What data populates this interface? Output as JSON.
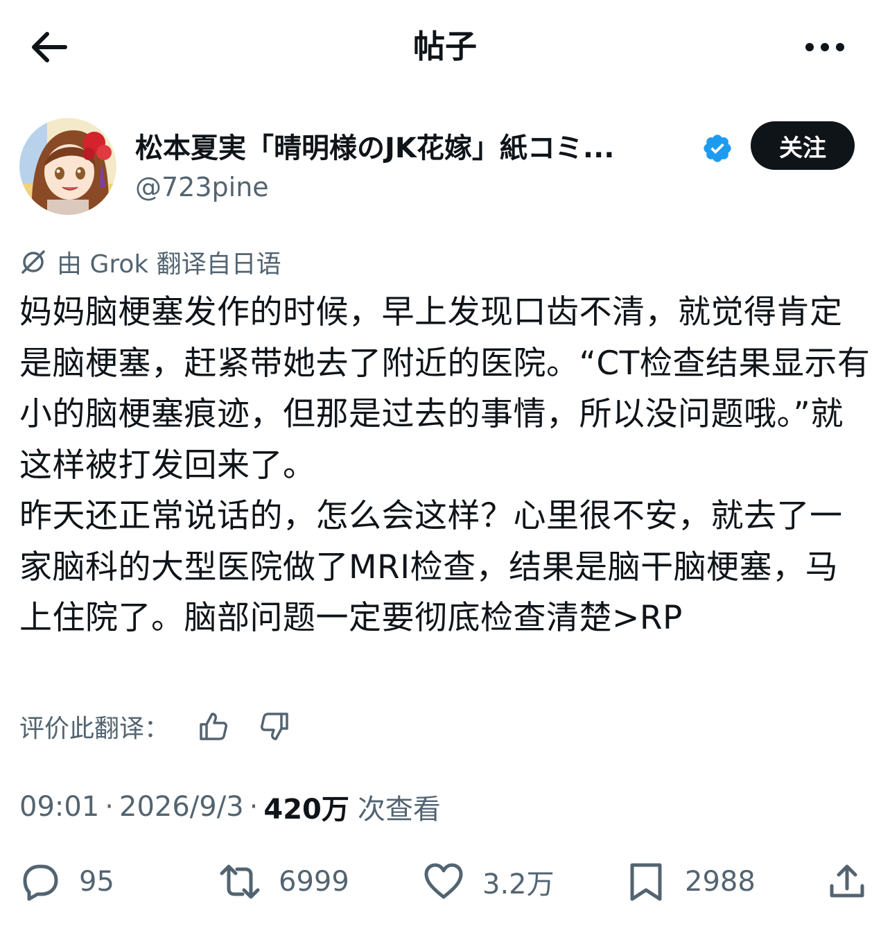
{
  "header": {
    "title": "帖子"
  },
  "author": {
    "display_name": "松本夏実「晴明様のJK花嫁」紙コミ...",
    "handle": "@723pine",
    "follow_label": "关注"
  },
  "translation": {
    "note": "由 Grok 翻译自日语",
    "rate_label": "评价此翻译："
  },
  "post": {
    "paragraph_1": "妈妈脑梗塞发作的时候，早上发现口齿不清，就觉得肯定是脑梗塞，赶紧带她去了附近的医院。“CT检查结果显示有小的脑梗塞痕迹，但那是过去的事情，所以没问题哦。”就这样被打发回来了。",
    "paragraph_2": "昨天还正常说话的，怎么会这样？心里很不安，就去了一家脑科的大型医院做了MRI检查，结果是脑干脑梗塞，马上住院了。脑部问题一定要彻底检查清楚>RP"
  },
  "meta": {
    "time": "09:01",
    "date": "2026/9/3",
    "separator": "·",
    "views_count": "420万",
    "views_label": "次查看"
  },
  "actions": {
    "replies": "95",
    "reposts": "6999",
    "likes": "3.2万",
    "bookmarks": "2988"
  },
  "icons": {
    "back": "arrow-left-icon",
    "more": "more-horizontal-icon",
    "verified": "verified-badge-icon",
    "grok": "grok-icon",
    "thumb_up": "thumbs-up-icon",
    "thumb_down": "thumbs-down-icon",
    "reply": "reply-icon",
    "repost": "repost-icon",
    "like": "heart-icon",
    "bookmark": "bookmark-icon",
    "share": "share-icon"
  },
  "colors": {
    "text": "#0f1419",
    "secondary": "#536471",
    "verified": "#1d9bf0",
    "follow_bg": "#0f1419"
  }
}
